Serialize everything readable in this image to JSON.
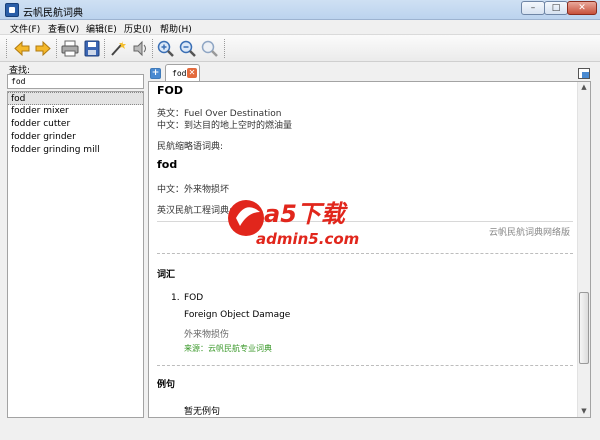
{
  "window": {
    "title": "云帆民航词典",
    "buttons": {
      "minimize": "–",
      "maximize": "□",
      "close": "✕"
    }
  },
  "menu": [
    "文件(F)",
    "查看(V)",
    "编辑(E)",
    "历史(I)",
    "帮助(H)"
  ],
  "toolbar": {
    "icons": [
      "back-arrow-icon",
      "forward-arrow-icon",
      "print-icon",
      "save-icon",
      "magic-wand-icon",
      "speaker-icon",
      "zoom-in-icon",
      "zoom-out-icon",
      "zoom-reset-icon"
    ]
  },
  "search": {
    "label": "查找:",
    "value": "fod"
  },
  "word_list": [
    "fod",
    "fodder mixer",
    "fodder cutter",
    "fodder grinder",
    "fodder grinding mill"
  ],
  "tab": {
    "label": "fod",
    "add": "+",
    "close": "✕"
  },
  "entry": {
    "headword": "FOD",
    "english": "英文：Fuel Over Destination",
    "chinese": "中文：到达目的地上空时的燃油量",
    "source1": "民航缩略语词典:",
    "headword2": "fod",
    "chinese2": "中文：外来物损坏",
    "source2": "英汉民航工程词典:",
    "footer_source": "云帆民航词典网络版",
    "vocab_title": "词汇",
    "vocab_number": "1.",
    "vocab_term": "FOD",
    "vocab_full": "Foreign Object Damage",
    "vocab_zh": "外来物损伤",
    "vocab_source": "来源：云帆民航专业词典",
    "examples_title": "例句",
    "no_examples": "暂无例句"
  },
  "watermark": {
    "brand": "a5下载",
    "site": "admin5.com"
  },
  "colors": {
    "accent": "#4a8ad1",
    "source_green": "#3c9a2c",
    "watermark_red": "#e1261c"
  }
}
